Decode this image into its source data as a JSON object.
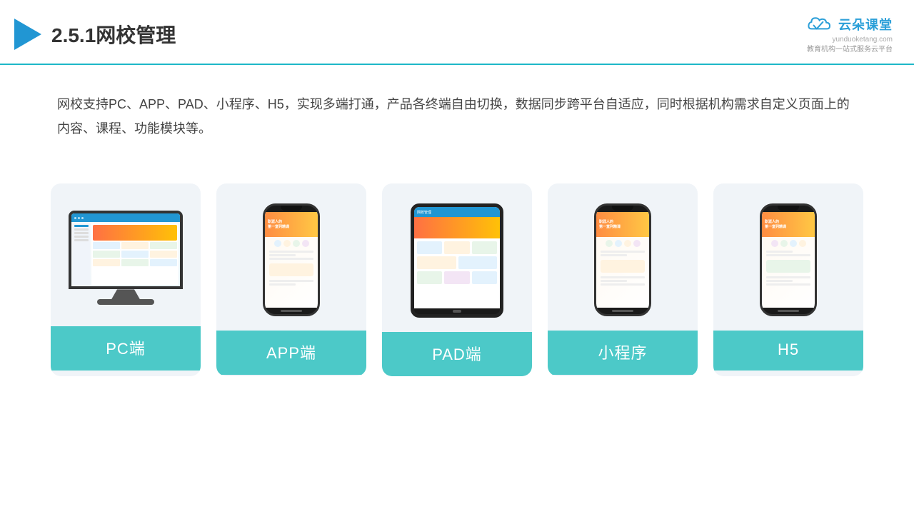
{
  "header": {
    "title": "2.5.1网校管理",
    "logo_text": "云朵课堂",
    "logo_domain": "yunduoketang.com",
    "logo_tagline": "教育机构一站\n式服务云平台"
  },
  "description": {
    "text": "网校支持PC、APP、PAD、小程序、H5，实现多端打通，产品各终端自由切换，数据同步跨平台自适应，同时根据机构需求自定义页面上的内容、课程、功能模块等。"
  },
  "cards": [
    {
      "id": "pc",
      "label": "PC端"
    },
    {
      "id": "app",
      "label": "APP端"
    },
    {
      "id": "pad",
      "label": "PAD端"
    },
    {
      "id": "miniapp",
      "label": "小程序"
    },
    {
      "id": "h5",
      "label": "H5"
    }
  ]
}
